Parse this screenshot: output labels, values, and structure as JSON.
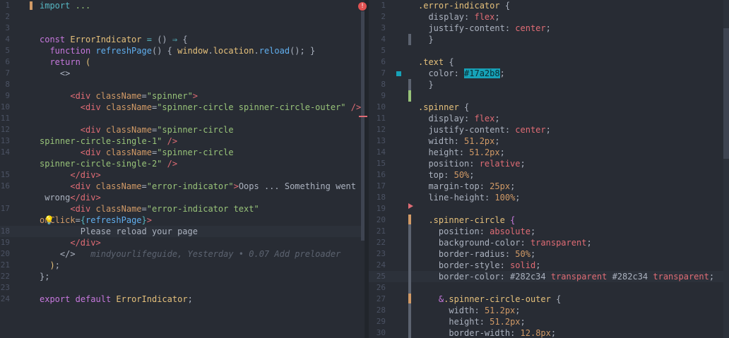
{
  "left_editor": {
    "lines": [
      {
        "n": "1",
        "html": "<span class='op'>import</span> <span class='str'>...</span>"
      },
      {
        "n": "2",
        "html": ""
      },
      {
        "n": "3",
        "html": ""
      },
      {
        "n": "4",
        "html": "<span class='kw'>const</span> <span class='cls'>ErrorIndicator</span> <span class='op'>=</span> () <span class='op'>⇒</span> {"
      },
      {
        "n": "5",
        "html": "  <span class='kw'>function</span> <span class='fn'>refreshPage</span>() { <span class='cls'>window</span>.<span class='cls'>location</span>.<span class='fn'>reload</span>(); }"
      },
      {
        "n": "6",
        "html": "  <span class='kw'>return</span> <span class='cls'>(</span>"
      },
      {
        "n": "7",
        "html": "    <span class='pl'>&lt;&gt;</span>"
      },
      {
        "n": "8",
        "html": ""
      },
      {
        "n": "9",
        "html": "      <span class='tag'>&lt;div</span> <span class='attr'>className</span>=<span class='str'>\"spinner\"</span><span class='tag'>&gt;</span>"
      },
      {
        "n": "10",
        "html": "        <span class='tag'>&lt;div</span> <span class='attr'>className</span>=<span class='str'>\"spinner-circle spinner-circle-outer\"</span> <span class='tag'>/&gt;</span>"
      },
      {
        "n": "11",
        "html": ""
      },
      {
        "n": "12",
        "html": "        <span class='tag'>&lt;div</span> <span class='attr'>className</span>=<span class='str'>\"spinner-circle</span>"
      },
      {
        "n": "13",
        "html": "<span class='str'>spinner-circle-single-1\"</span> <span class='tag'>/&gt;</span>"
      },
      {
        "n": "14",
        "html": "        <span class='tag'>&lt;div</span> <span class='attr'>className</span>=<span class='str'>\"spinner-circle</span>"
      },
      {
        "n": "",
        "html": "<span class='str'>spinner-circle-single-2\"</span> <span class='tag'>/&gt;</span>"
      },
      {
        "n": "15",
        "html": "      <span class='tag'>&lt;/div&gt;</span>"
      },
      {
        "n": "16",
        "html": "      <span class='tag'>&lt;div</span> <span class='attr'>className</span>=<span class='str'>\"error-indicator\"</span><span class='tag'>&gt;</span>Oops ... Something went"
      },
      {
        "n": "",
        "html": " wrong<span class='tag'>&lt;/div&gt;</span>"
      },
      {
        "n": "17",
        "html": "      <span class='tag'>&lt;div</span> <span class='attr'>className</span>=<span class='str'>\"error-indicator text\"</span>"
      },
      {
        "n": "",
        "html": "<span class='attr'>onClick</span>=<span class='op'>{</span><span class='fn'>refreshPage</span><span class='op'>}</span><span class='tag'>&gt;</span>"
      },
      {
        "n": "18",
        "html": "        Please reload your page"
      },
      {
        "n": "19",
        "html": "      <span class='tag'>&lt;/div&gt;</span>"
      },
      {
        "n": "20",
        "html": "    <span class='pl'>&lt;/&gt;</span>   <span class='blame'>mindyourlifeguide, Yesterday • 0.07 Add preloader</span>"
      },
      {
        "n": "21",
        "html": "  <span class='cls'>)</span>;"
      },
      {
        "n": "22",
        "html": "};"
      },
      {
        "n": "23",
        "html": ""
      },
      {
        "n": "24",
        "html": "<span class='kw'>export</span> <span class='kw'>default</span> <span class='cls'>ErrorIndicator</span>;"
      }
    ]
  },
  "right_editor": {
    "lines": [
      {
        "n": "1",
        "html": "<span class='sel'>.error-indicator</span> {"
      },
      {
        "n": "2",
        "html": "  <span class='prop'>display</span>: <span class='val'>flex</span>;"
      },
      {
        "n": "3",
        "html": "  <span class='prop'>justify-content</span>: <span class='val'>center</span>;"
      },
      {
        "n": "4",
        "html": "  }"
      },
      {
        "n": "5",
        "html": ""
      },
      {
        "n": "6",
        "html": "<span class='sel'>.text</span> {"
      },
      {
        "n": "7",
        "html": "  <span class='prop'>color</span>: <span class='hexbox'>#17a2b8</span>;"
      },
      {
        "n": "8",
        "html": "  }"
      },
      {
        "n": "9",
        "html": ""
      },
      {
        "n": "10",
        "html": "<span class='sel'>.spinner</span> {"
      },
      {
        "n": "11",
        "html": "  <span class='prop'>display</span>: <span class='val'>flex</span>;"
      },
      {
        "n": "12",
        "html": "  <span class='prop'>justify-content</span>: <span class='val'>center</span>;"
      },
      {
        "n": "13",
        "html": "  <span class='prop'>width</span>: <span class='num-v'>51.2px</span>;"
      },
      {
        "n": "14",
        "html": "  <span class='prop'>height</span>: <span class='num-v'>51.2px</span>;"
      },
      {
        "n": "15",
        "html": "  <span class='prop'>position</span>: <span class='val'>relative</span>;"
      },
      {
        "n": "16",
        "html": "  <span class='prop'>top</span>: <span class='num-v'>50%</span>;"
      },
      {
        "n": "17",
        "html": "  <span class='prop'>margin-top</span>: <span class='num-v'>25px</span>;"
      },
      {
        "n": "18",
        "html": "  <span class='prop'>line-height</span>: <span class='num-v'>100%</span>;"
      },
      {
        "n": "19",
        "html": ""
      },
      {
        "n": "20",
        "html": "  <span class='sel'>.spinner-circle</span> <span class='kw'>{</span>"
      },
      {
        "n": "21",
        "html": "    <span class='prop'>position</span>: <span class='val'>absolute</span>;"
      },
      {
        "n": "22",
        "html": "    <span class='prop'>background-color</span>: <span class='val'>transparent</span>;"
      },
      {
        "n": "23",
        "html": "    <span class='prop'>border-radius</span>: <span class='num-v'>50%</span>;"
      },
      {
        "n": "24",
        "html": "    <span class='prop'>border-style</span>: <span class='val'>solid</span>;"
      },
      {
        "n": "25",
        "html": "    <span class='prop'>border-color</span>: #282c34 <span class='val'>transparent</span> #282c34 <span class='val'>transparent</span>;"
      },
      {
        "n": "26",
        "html": ""
      },
      {
        "n": "27",
        "html": "    <span class='kw'>&amp;</span><span class='sel'>.spinner-circle-outer</span> {"
      },
      {
        "n": "28",
        "html": "      <span class='prop'>width</span>: <span class='num-v'>51.2px</span>;"
      },
      {
        "n": "29",
        "html": "      <span class='prop'>height</span>: <span class='num-v'>51.2px</span>;"
      },
      {
        "n": "30",
        "html": "      <span class='prop'>border-width</span>: <span class='num-v'>12.8px</span>;"
      }
    ]
  },
  "markers": {
    "error_badge": "!",
    "lightbulb": "💡"
  }
}
